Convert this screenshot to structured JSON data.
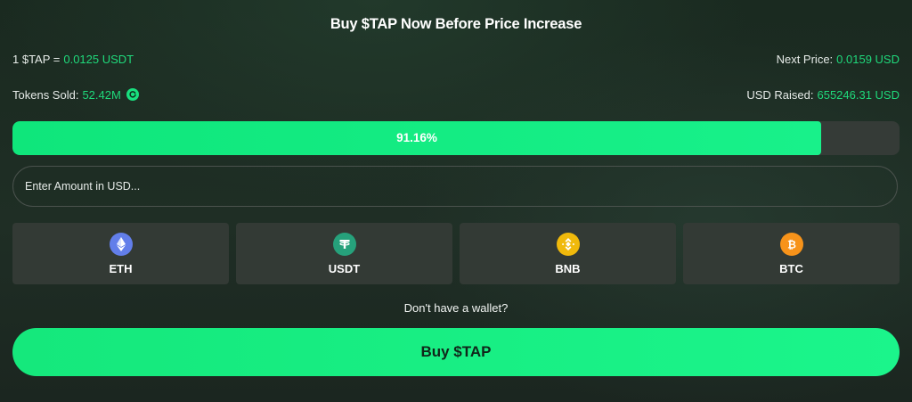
{
  "header": {
    "title": "Buy $TAP Now Before Price Increase"
  },
  "price": {
    "current_label": "1 $TAP = ",
    "current_value": "0.0125 USDT",
    "next_label": "Next Price: ",
    "next_value": "0.0159 USD"
  },
  "stats": {
    "sold_label": "Tokens Sold: ",
    "sold_value": "52.42M",
    "raised_label": "USD Raised: ",
    "raised_value": "655246.31 USD"
  },
  "progress": {
    "percent": 91.16,
    "label": "91.16%"
  },
  "amount_input": {
    "placeholder": "Enter Amount in USD...",
    "value": ""
  },
  "currencies": [
    {
      "label": "ETH",
      "icon": "ethereum-icon",
      "color": "#627eea"
    },
    {
      "label": "USDT",
      "icon": "tether-icon",
      "color": "#26a17b"
    },
    {
      "label": "BNB",
      "icon": "bnb-icon",
      "color": "#f0b90b"
    },
    {
      "label": "BTC",
      "icon": "bitcoin-icon",
      "color": "#f7931a"
    }
  ],
  "wallet_link": "Don't have a wallet?",
  "buy_button": "Buy $TAP",
  "colors": {
    "accent": "#19e882",
    "panel": "#333a35",
    "background": "#1f2e25"
  }
}
